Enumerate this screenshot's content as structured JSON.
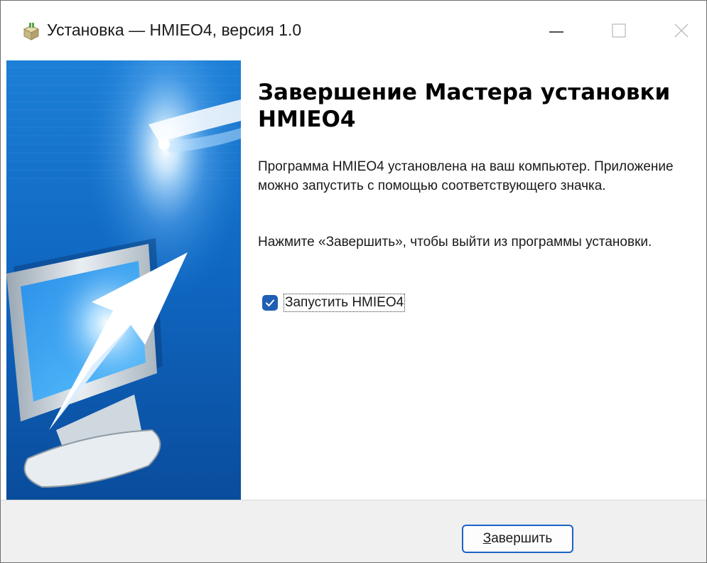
{
  "window": {
    "title": "Установка — HMIEO4, версия 1.0"
  },
  "content": {
    "heading": "Завершение Мастера установки HMIEO4",
    "paragraph1": "Программа HMIEO4 установлена на ваш компьютер. Приложение можно запустить с помощью соответствующего значка.",
    "paragraph2": "Нажмите «Завершить», чтобы выйти из программы установки.",
    "launch_checkbox": {
      "label": "Запустить HMIEO4",
      "checked": true
    }
  },
  "footer": {
    "finish_button": {
      "accel": "З",
      "rest": "авершить"
    }
  },
  "colors": {
    "accent": "#1f5fb4",
    "banner_blue": "#0c5fb8",
    "footer_bg": "#f0f0f0"
  },
  "icons": {
    "app": "installer-box-icon",
    "minimize": "minimize-icon",
    "maximize": "maximize-icon",
    "close": "close-icon",
    "check": "checkmark-icon"
  }
}
